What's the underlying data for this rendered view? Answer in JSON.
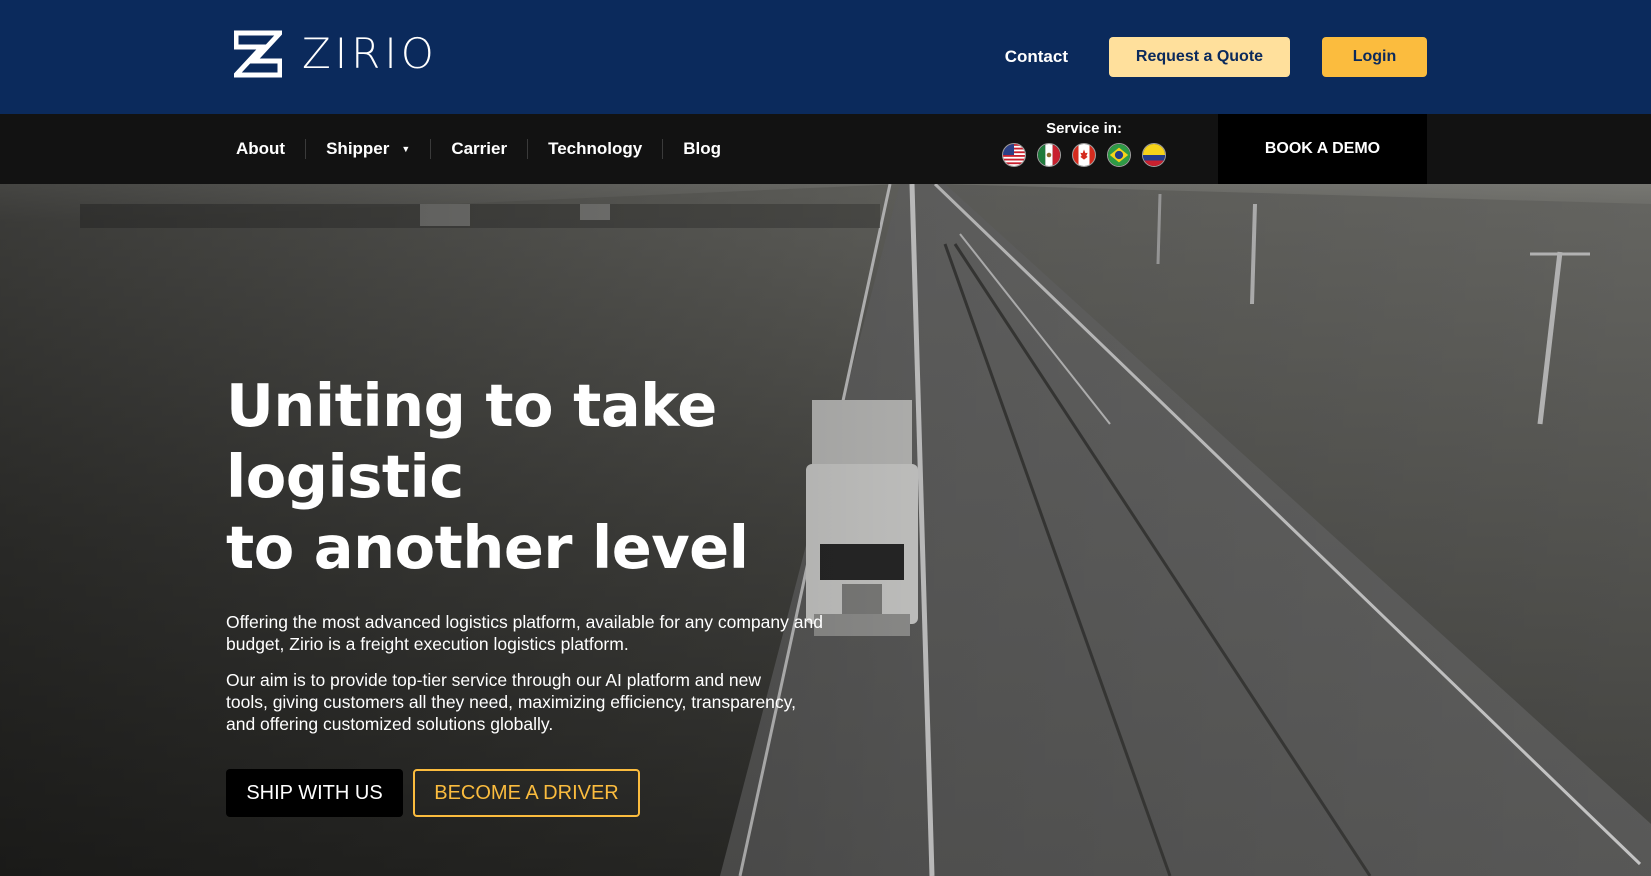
{
  "brand": {
    "name": "ZIRIO"
  },
  "header": {
    "contact_label": "Contact",
    "quote_label": "Request a Quote",
    "login_label": "Login"
  },
  "nav": {
    "items": [
      {
        "label": "About"
      },
      {
        "label": "Shipper"
      },
      {
        "label": "Carrier"
      },
      {
        "label": "Technology"
      },
      {
        "label": "Blog"
      }
    ],
    "service_label": "Service in:",
    "flags": [
      "us-flag-icon",
      "mexico-flag-icon",
      "canada-flag-icon",
      "brazil-flag-icon",
      "colombia-flag-icon"
    ],
    "demo_label": "BOOK A DEMO"
  },
  "hero": {
    "title_line1": "Uniting to take logistic",
    "title_line2": "to another level",
    "paragraph1": "Offering the most advanced logistics platform, available for any company and budget, Zirio is a freight execution logistics platform.",
    "paragraph2": "Our aim is to provide top-tier service through our AI platform and new tools, giving customers all they need, maximizing efficiency, transparency, and offering customized solutions globally.",
    "ship_label": "SHIP WITH US",
    "driver_label": "BECOME A DRIVER"
  },
  "colors": {
    "header_bg": "#0b2a5c",
    "nav_bg": "#121212",
    "accent": "#fbbc3e",
    "accent_light": "#ffe09c"
  }
}
